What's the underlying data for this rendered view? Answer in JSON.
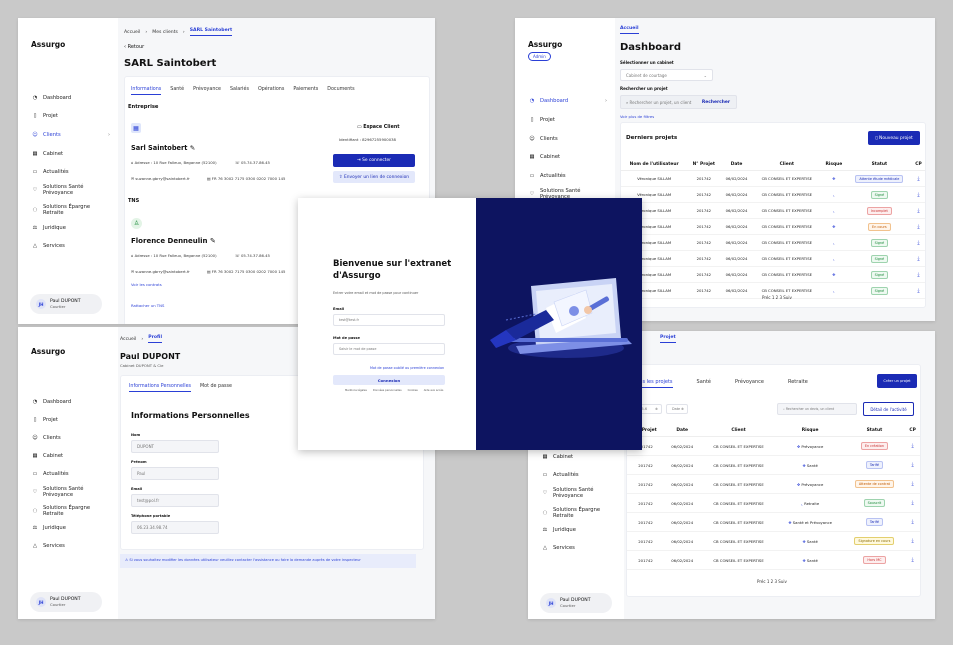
{
  "sidebar_items": [
    "Dashboard",
    "Projet",
    "Clients",
    "Cabinet",
    "Actualités",
    "Solutions Santé Prévoyance",
    "Solutions Épargne Retraite",
    "Juridique",
    "Services"
  ],
  "logo": "Assurgo",
  "user": {
    "name": "Paul DUPONT",
    "role": "Courtier",
    "initials": "JH"
  },
  "p1": {
    "breadcrumb": [
      "Accueil",
      "Mes clients",
      "SARL Saintobert"
    ],
    "back": "Retour",
    "title": "SARL Saintobert",
    "tabs": [
      "Informations",
      "Santé",
      "Prévoyance",
      "Salariés",
      "Opérations",
      "Paiements",
      "Documents"
    ],
    "entreprise_label": "Entreprise",
    "company": {
      "name": "Sarl Saintobert",
      "address": "Adresse : 10 Rue Falleux, Beganne (52100)",
      "phone": "05.74.37.86.45",
      "email": "suzanne.gbrry@saintobert.fr",
      "siret": "FR 76 3002 7175 0300 0202 7000 145"
    },
    "espace": {
      "title": "Espace Client",
      "id": "Identifiant : 82967255900038",
      "btn_connect": "Se connecter",
      "btn_link": "Envoyer un lien de connexion"
    },
    "tns_label": "TNS",
    "person": {
      "name": "Florence Denneulin",
      "address": "Adresse : 10 Rue Falleux, Beganne (52100)",
      "phone": "05.74.37.86.45",
      "email": "suzanne.gbrry@saintobert.fr",
      "siret": "FR 76 3002 7175 0300 0202 7000 145",
      "link": "Voir les contrats"
    },
    "add_tns": "Rattacher un TNS"
  },
  "p2": {
    "breadcrumb": "Accueil",
    "admin": "Admin",
    "title": "Dashboard",
    "select_cabinet": "Sélectionner un cabinet",
    "cabinet_value": "Cabinet de courtage",
    "search_label": "Rechercher un projet",
    "search_ph": "Rechercher un projet, un client",
    "search_btn": "Rechercher",
    "more_filters": "Voir plus de filtres",
    "section": "Derniers projets",
    "new_btn": "Nouveau projet",
    "headers": [
      "Nom de l'utilisateur",
      "N° Projet",
      "Date",
      "Client",
      "Risque",
      "Statut",
      "CP"
    ],
    "rows": [
      [
        "Véronique SILLAM",
        "201742",
        "06/02/2024",
        "CB CONSEIL ET EXPERTISE",
        "Attente étude médicale"
      ],
      [
        "Véronique SILLAM",
        "201742",
        "06/02/2024",
        "CB CONSEIL ET EXPERTISE",
        "Signé"
      ],
      [
        "Véronique SILLAM",
        "201742",
        "06/02/2024",
        "CB CONSEIL ET EXPERTISE",
        "Incomplet"
      ],
      [
        "Véronique SILLAM",
        "201742",
        "06/02/2024",
        "CB CONSEIL ET EXPERTISE",
        "En cours"
      ],
      [
        "Véronique SILLAM",
        "201742",
        "06/02/2024",
        "CB CONSEIL ET EXPERTISE",
        "Signé"
      ],
      [
        "Véronique SILLAM",
        "201742",
        "06/02/2024",
        "CB CONSEIL ET EXPERTISE",
        "Signé"
      ],
      [
        "Véronique SILLAM",
        "201742",
        "06/02/2024",
        "CB CONSEIL ET EXPERTISE",
        "Signé"
      ],
      [
        "Véronique SILLAM",
        "201742",
        "06/02/2024",
        "CB CONSEIL ET EXPERTISE",
        "Signé"
      ]
    ],
    "pager": "Préc 1 2 3 Suiv"
  },
  "p3": {
    "breadcrumb": [
      "Accueil",
      "Profil"
    ],
    "name": "Paul DUPONT",
    "company": "Cabinet DUPONT & Cie",
    "tabs": [
      "Informations Personnelles",
      "Mot de passe"
    ],
    "section": "Informations Personnelles",
    "fields": [
      {
        "label": "Nom",
        "value": "DUPONT"
      },
      {
        "label": "Prénom",
        "value": "Paul"
      },
      {
        "label": "Email",
        "value": "test@pol.fr"
      },
      {
        "label": "Téléphone portable",
        "value": "06.23.34.98.74"
      }
    ],
    "notice": "Si vous souhaitez modifier les données utilisateur veuillez contacter l'assistance ou faire la demande auprès de votre inspecteur"
  },
  "p4": {
    "title_line1": "Bienvenue sur l'extranet",
    "title_line2": "d'Assurgo",
    "subtitle": "Entrer votre email et mot de passe pour continuer",
    "email_label": "Email",
    "email_ph": "test@test.fr",
    "pwd_label": "Mot de passe",
    "pwd_ph": "Saisir le mot de passe",
    "forgot": "Mot de passe oublié ou première connexion",
    "btn": "Connexion",
    "footer": [
      "Mentions légales",
      "Données personnelles",
      "Cookies",
      "Aide aux accès"
    ]
  },
  "p5": {
    "breadcrumb": "Projet",
    "tabs": [
      "Toutes les projets",
      "Santé",
      "Prévoyance",
      "Retraite"
    ],
    "new_btn": "Créer un projet",
    "filter1": "2025-6",
    "filter2": "Date",
    "search_ph": "Rechercher un devis, un client",
    "detail_btn": "Détail de l'activité",
    "headers": [
      "N° Projet",
      "Date",
      "Client",
      "Risque",
      "Statut",
      "CP"
    ],
    "rows": [
      [
        "201742",
        "06/02/2024",
        "CB CONSEIL ET EXPERTISE",
        "Prévoyance",
        "En création"
      ],
      [
        "201742",
        "06/02/2024",
        "CB CONSEIL ET EXPERTISE",
        "Santé",
        "Tarifé"
      ],
      [
        "201742",
        "06/02/2024",
        "CB CONSEIL ET EXPERTISE",
        "Prévoyance",
        "Attente de contrat"
      ],
      [
        "201742",
        "06/02/2024",
        "CB CONSEIL ET EXPERTISE",
        "Retraite",
        "Souscrit"
      ],
      [
        "201742",
        "06/02/2024",
        "CB CONSEIL ET EXPERTISE",
        "Santé et Prévoyance",
        "Tarifé"
      ],
      [
        "201742",
        "06/02/2024",
        "CB CONSEIL ET EXPERTISE",
        "Santé",
        "Signature en cours"
      ],
      [
        "201742",
        "06/02/2024",
        "CB CONSEIL ET EXPERTISE",
        "Santé",
        "Hors MC"
      ]
    ],
    "pager": "Préc 1 2 3 Suiv"
  }
}
